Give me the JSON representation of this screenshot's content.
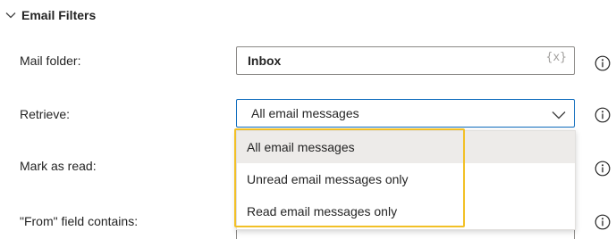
{
  "section": {
    "title": "Email Filters",
    "collapse_icon": "chevron-down-icon"
  },
  "fields": {
    "mail_folder": {
      "label": "Mail folder:",
      "value": "Inbox",
      "variable_icon": "{x}"
    },
    "retrieve": {
      "label": "Retrieve:",
      "value": "All email messages"
    },
    "mark_as_read": {
      "label": "Mark as read:"
    },
    "from_contains": {
      "label": "\"From\" field contains:"
    }
  },
  "dropdown": {
    "options": [
      "All email messages",
      "Unread email messages only",
      "Read email messages only"
    ],
    "selected": "All email messages"
  },
  "colors": {
    "focus_border": "#0f6cbd",
    "highlight": "#f2c026",
    "selected_bg": "#edebe9"
  },
  "icons": {
    "info": "info-icon",
    "dropdown": "chevron-down-icon"
  }
}
